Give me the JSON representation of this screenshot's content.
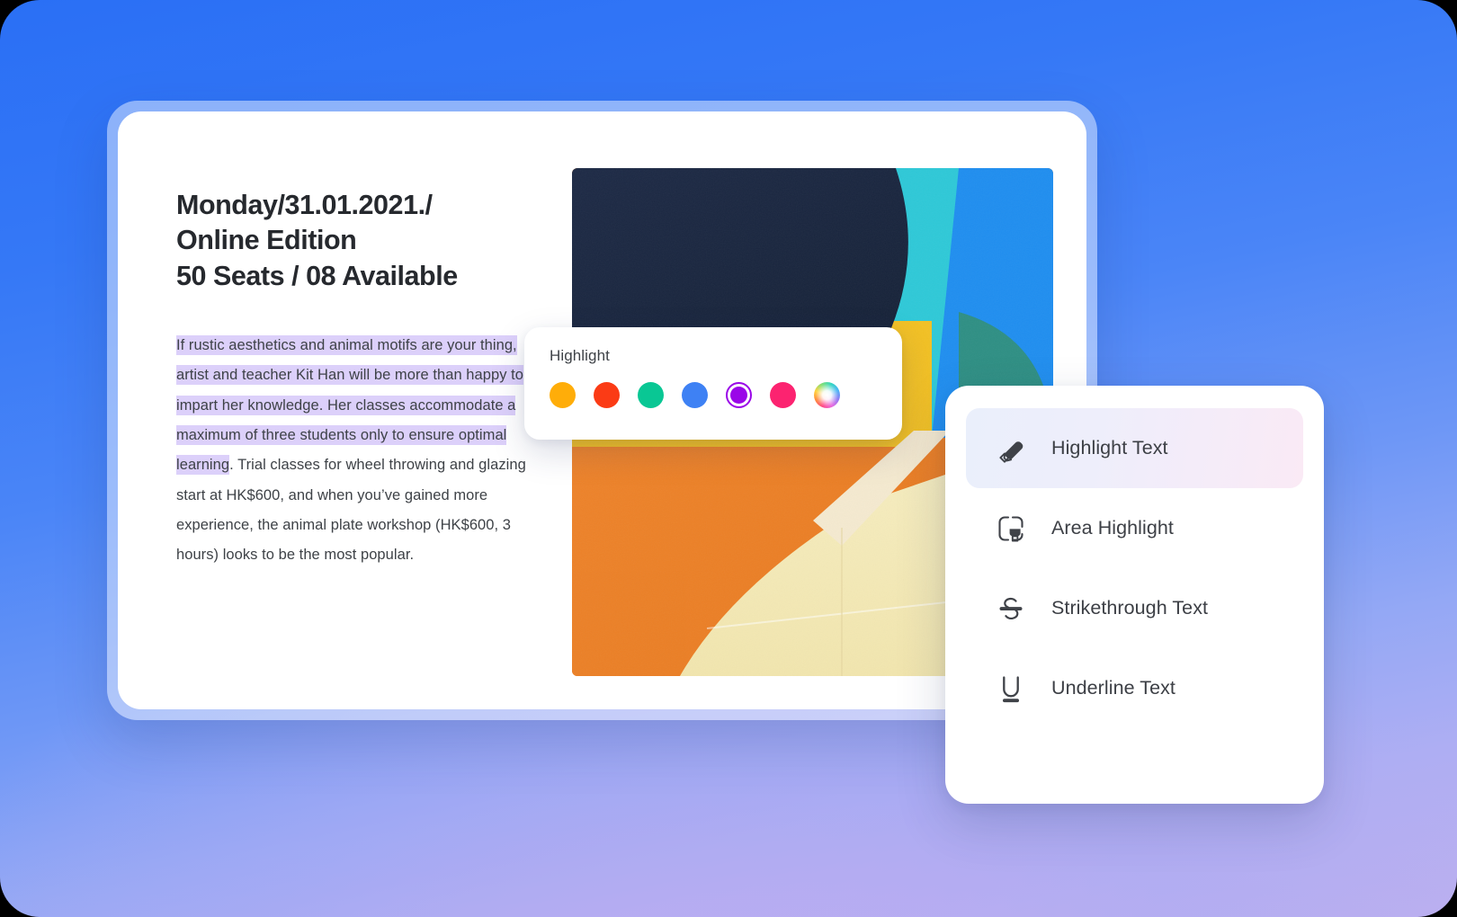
{
  "background": {
    "gradient_from": "#2a6ff5",
    "gradient_mid": "#6e97f6",
    "gradient_to": "#bdb0ef"
  },
  "document_card": {
    "title": "Monday/31.01.2021./\nOnline Edition\n50 Seats / 08 Available",
    "body": {
      "highlighted_text": "If rustic aesthetics and animal motifs are your thing, artist and teacher Kit Han will be more than happy to impart her knowledge. Her classes accommodate a maximum of three students only to ensure optimal learning",
      "rest_text": ". Trial classes for wheel throwing and glazing start at HK$600, and when you’ve gained more experience, the animal plate workshop (HK$600, 3 hours) looks to be the most popular.",
      "highlight_color": "#dcd0fa"
    },
    "artwork_alt": "abstract painted wall mural"
  },
  "highlight_popup": {
    "label": "Highlight",
    "swatches": [
      {
        "name": "swatch-orange",
        "color": "#FFAD09",
        "selected": false
      },
      {
        "name": "swatch-red",
        "color": "#FB3B15",
        "selected": false
      },
      {
        "name": "swatch-green",
        "color": "#09C794",
        "selected": false
      },
      {
        "name": "swatch-blue",
        "color": "#3E81F4",
        "selected": false
      },
      {
        "name": "swatch-purple",
        "color": "#9A06E8",
        "selected": true
      },
      {
        "name": "swatch-pink",
        "color": "#FC2370",
        "selected": false
      },
      {
        "name": "swatch-custom-color-wheel",
        "color": "wheel",
        "selected": false
      }
    ]
  },
  "context_menu": {
    "items": [
      {
        "icon": "highlighter-pen-icon",
        "label": "Highlight Text",
        "active": true
      },
      {
        "icon": "area-highlight-icon",
        "label": "Area Highlight",
        "active": false
      },
      {
        "icon": "strikethrough-icon",
        "label": "Strikethrough Text",
        "active": false
      },
      {
        "icon": "underline-icon",
        "label": "Underline Text",
        "active": false
      }
    ],
    "active_gradient_from": "#eaeffb",
    "active_gradient_to": "#faeaf5"
  }
}
